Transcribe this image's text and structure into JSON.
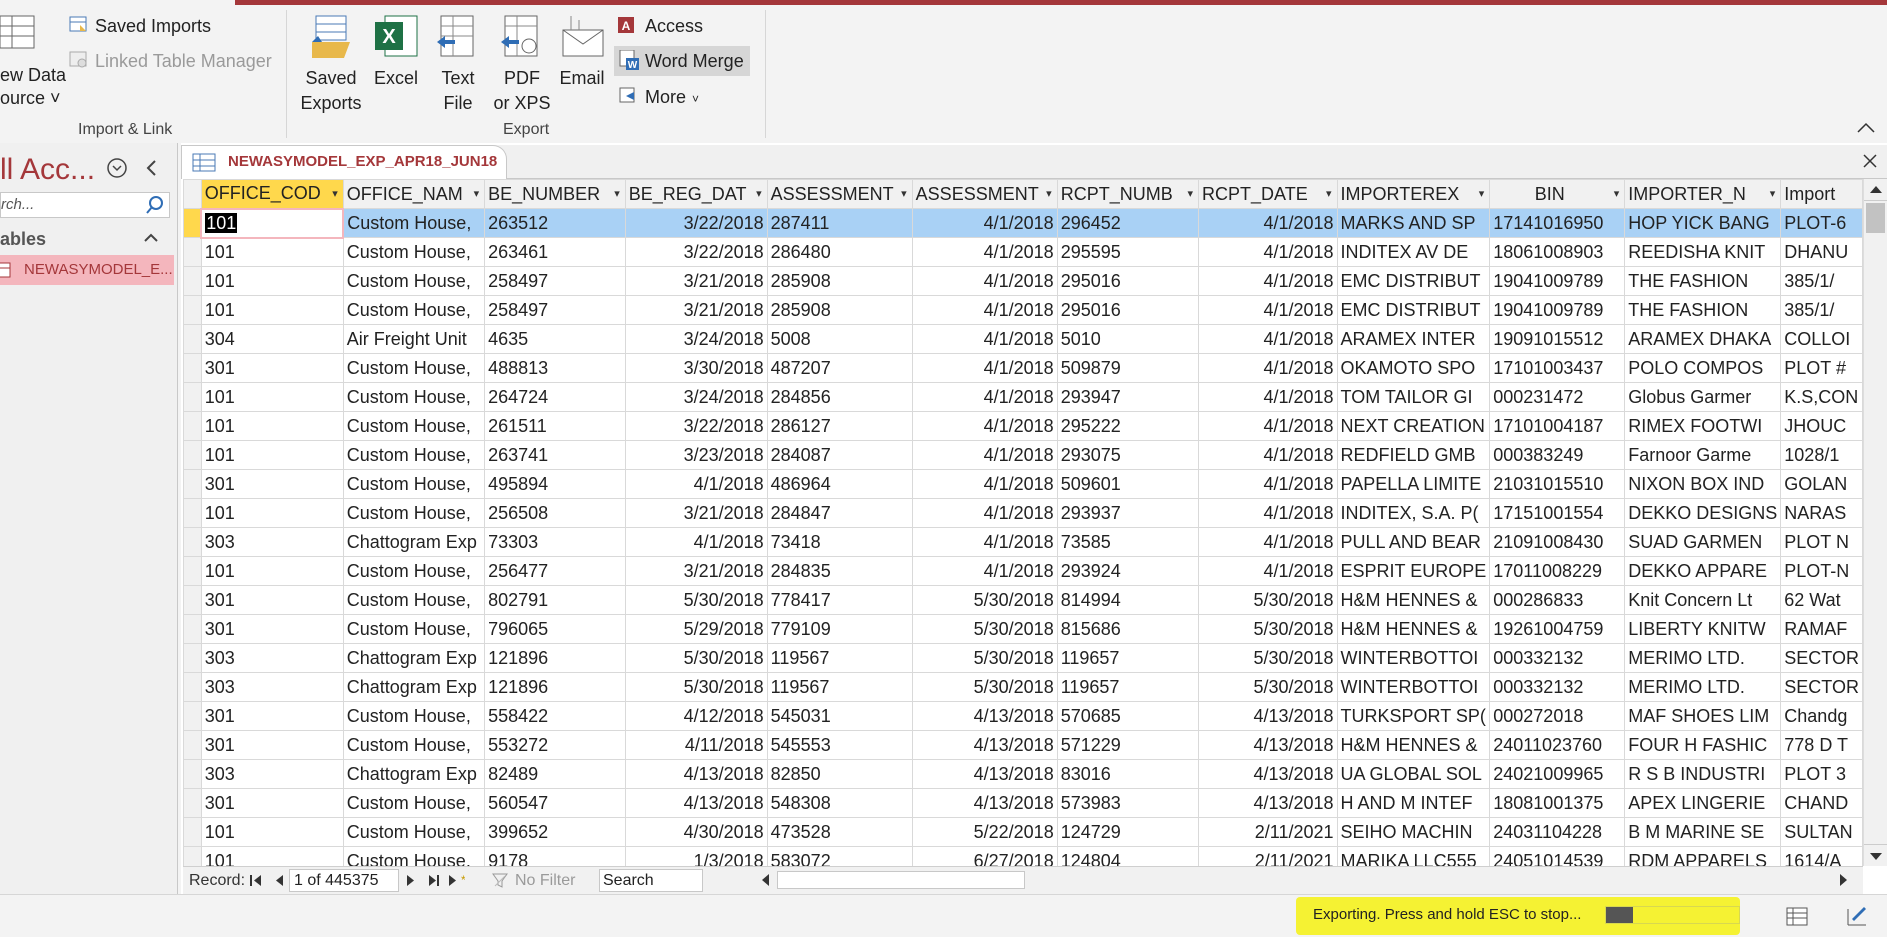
{
  "ribbon": {
    "saved_imports": "Saved Imports",
    "linked_table_manager": "Linked Table Manager",
    "new_data_source_line1": "ew Data",
    "new_data_source_line2": "ource ˅",
    "saved_exports_line1": "Saved",
    "saved_exports_line2": "Exports",
    "excel": "Excel",
    "text_file_line1": "Text",
    "text_file_line2": "File",
    "pdf_line1": "PDF",
    "pdf_line2": "or XPS",
    "email": "Email",
    "access": "Access",
    "word_merge": "Word Merge",
    "more": "More",
    "group_import": "Import & Link",
    "group_export": "Export"
  },
  "navpane": {
    "title": "ll Acc...",
    "search_placeholder": "rch...",
    "section": "ables",
    "item": "NEWASYMODEL_E..."
  },
  "document": {
    "tab_label": "NEWASYMODEL_EXP_APR18_JUN18"
  },
  "grid": {
    "columns": [
      "OFFICE_COD",
      "OFFICE_NAM",
      "BE_NUMBER",
      "BE_REG_DAT",
      "ASSESSMENT",
      "ASSESSMENT",
      "RCPT_NUMB",
      "RCPT_DATE",
      "IMPORTEREX",
      "BIN",
      "IMPORTER_N",
      "Import"
    ],
    "rows": [
      [
        "101",
        "Custom House,",
        "263512",
        "3/22/2018",
        "287411",
        "4/1/2018",
        "296452",
        "4/1/2018",
        "MARKS AND SP",
        "17141016950",
        "HOP YICK BANG",
        "PLOT-6"
      ],
      [
        "101",
        "Custom House,",
        "263461",
        "3/22/2018",
        "286480",
        "4/1/2018",
        "295595",
        "4/1/2018",
        "INDITEX AV DE",
        "18061008903",
        "REEDISHA KNIT",
        "DHANU"
      ],
      [
        "101",
        "Custom House,",
        "258497",
        "3/21/2018",
        "285908",
        "4/1/2018",
        "295016",
        "4/1/2018",
        "EMC DISTRIBUT",
        "19041009789",
        "THE  FASHION",
        "385/1/"
      ],
      [
        "101",
        "Custom House,",
        "258497",
        "3/21/2018",
        "285908",
        "4/1/2018",
        "295016",
        "4/1/2018",
        "EMC DISTRIBUT",
        "19041009789",
        "THE  FASHION",
        "385/1/"
      ],
      [
        "304",
        "Air Freight Unit",
        "4635",
        "3/24/2018",
        "5008",
        "4/1/2018",
        "5010",
        "4/1/2018",
        "ARAMEX INTER",
        "19091015512",
        "ARAMEX DHAKA",
        "COLLOI"
      ],
      [
        "301",
        "Custom House,",
        "488813",
        "3/30/2018",
        "487207",
        "4/1/2018",
        "509879",
        "4/1/2018",
        "OKAMOTO SPO",
        "17101003437",
        "POLO COMPOS",
        "PLOT #"
      ],
      [
        "101",
        "Custom House,",
        "264724",
        "3/24/2018",
        "284856",
        "4/1/2018",
        "293947",
        "4/1/2018",
        "TOM TAILOR GI",
        "000231472",
        "Globus Garmer",
        "K.S,CON"
      ],
      [
        "101",
        "Custom House,",
        "261511",
        "3/22/2018",
        "286127",
        "4/1/2018",
        "295222",
        "4/1/2018",
        "NEXT CREATION",
        "17101004187",
        "RIMEX FOOTWI",
        "JHOUC"
      ],
      [
        "101",
        "Custom House,",
        "263741",
        "3/23/2018",
        "284087",
        "4/1/2018",
        "293075",
        "4/1/2018",
        "REDFIELD GMB",
        "000383249",
        "Farnoor Garme",
        "1028/1"
      ],
      [
        "301",
        "Custom House,",
        "495894",
        "4/1/2018",
        "486964",
        "4/1/2018",
        "509601",
        "4/1/2018",
        "PAPELLA LIMITE",
        "21031015510",
        "NIXON BOX IND",
        "GOLAN"
      ],
      [
        "101",
        "Custom House,",
        "256508",
        "3/21/2018",
        "284847",
        "4/1/2018",
        "293937",
        "4/1/2018",
        "INDITEX, S.A. P(",
        "17151001554",
        "DEKKO DESIGNS",
        "NARAS"
      ],
      [
        "303",
        "Chattogram Exp",
        "73303",
        "4/1/2018",
        "73418",
        "4/1/2018",
        "73585",
        "4/1/2018",
        "PULL AND BEAR",
        "21091008430",
        "SUAD GARMEN",
        "PLOT N"
      ],
      [
        "101",
        "Custom House,",
        "256477",
        "3/21/2018",
        "284835",
        "4/1/2018",
        "293924",
        "4/1/2018",
        "ESPRIT EUROPE",
        "17011008229",
        "DEKKO APPARE",
        "PLOT-N"
      ],
      [
        "301",
        "Custom House,",
        "802791",
        "5/30/2018",
        "778417",
        "5/30/2018",
        "814994",
        "5/30/2018",
        "H&M HENNES &",
        "000286833",
        "Knit Concern Lt",
        "62 Wat"
      ],
      [
        "301",
        "Custom House,",
        "796065",
        "5/29/2018",
        "779109",
        "5/30/2018",
        "815686",
        "5/30/2018",
        "H&M HENNES &",
        "19261004759",
        "LIBERTY KNITW",
        "RAMAF"
      ],
      [
        "303",
        "Chattogram Exp",
        "121896",
        "5/30/2018",
        "119567",
        "5/30/2018",
        "119657",
        "5/30/2018",
        "WINTERBOTTOI",
        "000332132",
        "MERIMO LTD.",
        "SECTOR"
      ],
      [
        "303",
        "Chattogram Exp",
        "121896",
        "5/30/2018",
        "119567",
        "5/30/2018",
        "119657",
        "5/30/2018",
        "WINTERBOTTOI",
        "000332132",
        "MERIMO LTD.",
        "SECTOR"
      ],
      [
        "301",
        "Custom House,",
        "558422",
        "4/12/2018",
        "545031",
        "4/13/2018",
        "570685",
        "4/13/2018",
        "TURKSPORT SP(",
        "000272018",
        "MAF SHOES LIM",
        "Chandg"
      ],
      [
        "301",
        "Custom House,",
        "553272",
        "4/11/2018",
        "545553",
        "4/13/2018",
        "571229",
        "4/13/2018",
        "H&M HENNES &",
        "24011023760",
        "FOUR H FASHIC",
        "778 D T"
      ],
      [
        "303",
        "Chattogram Exp",
        "82489",
        "4/13/2018",
        "82850",
        "4/13/2018",
        "83016",
        "4/13/2018",
        "UA GLOBAL SOL",
        "24021009965",
        "R S B INDUSTRI",
        "PLOT 3"
      ],
      [
        "301",
        "Custom House,",
        "560547",
        "4/13/2018",
        "548308",
        "4/13/2018",
        "573983",
        "4/13/2018",
        "H AND M INTEF",
        "18081001375",
        "APEX LINGERIE",
        "CHAND"
      ],
      [
        "101",
        "Custom House,",
        "399652",
        "4/30/2018",
        "473528",
        "5/22/2018",
        "124729",
        "2/11/2021",
        "SEIHO MACHIN",
        "24031104228",
        "B M MARINE SE",
        "SULTAN"
      ],
      [
        "101",
        "Custom House,",
        "9178",
        "1/3/2018",
        "583072",
        "6/27/2018",
        "124804",
        "2/11/2021",
        "MARIKA LLC555",
        "24051014539",
        "RDM APPARELS",
        "1614/A"
      ]
    ]
  },
  "recnav": {
    "record_label": "Record:",
    "position": "1 of 445375",
    "filter_label": "No Filter",
    "search_label": "Search"
  },
  "status": {
    "export_message": "Exporting. Press and hold ESC to stop...",
    "export_progress": 0.2,
    "highlight_color": "#f5f233"
  }
}
